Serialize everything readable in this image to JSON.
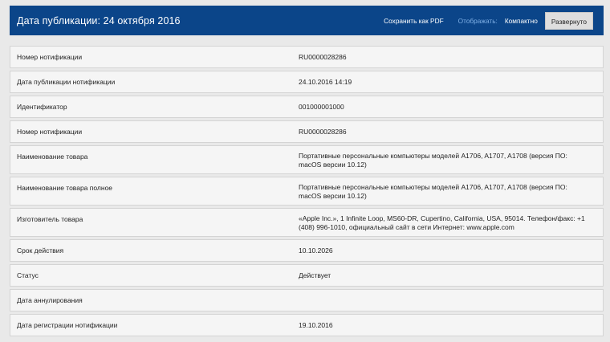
{
  "header": {
    "title": "Дата публикации: 24 октября 2016",
    "save_pdf": "Сохранить как PDF",
    "display_label": "Отображать:",
    "mode_compact": "Компактно",
    "mode_expanded": "Развернуто"
  },
  "rows": [
    {
      "label": "Номер нотификации",
      "value": "RU0000028286"
    },
    {
      "label": "Дата публикации нотификации",
      "value": "24.10.2016 14:19"
    },
    {
      "label": "Идентификатор",
      "value": "001000001000"
    },
    {
      "label": "Номер нотификации",
      "value": "RU0000028286"
    },
    {
      "label": "Наименование товара",
      "value": "Портативные персональные компьютеры моделей A1706, A1707, A1708 (версия ПО: macOS версии 10.12)"
    },
    {
      "label": "Наименование товара полное",
      "value": "Портативные персональные компьютеры моделей A1706, A1707, A1708 (версия ПО: macOS версии 10.12)"
    },
    {
      "label": "Изготовитель товара",
      "value": "«Apple Inc.», 1 Infinite Loop, MS60-DR, Cupertino, California, USA, 95014. Телефон/факс: +1 (408) 996-1010, официальный сайт в сети Интернет: www.apple.com"
    },
    {
      "label": "Срок действия",
      "value": "10.10.2026"
    },
    {
      "label": "Статус",
      "value": "Действует"
    },
    {
      "label": "Дата аннулирования",
      "value": ""
    },
    {
      "label": "Дата регистрации нотификации",
      "value": "19.10.2016"
    }
  ]
}
